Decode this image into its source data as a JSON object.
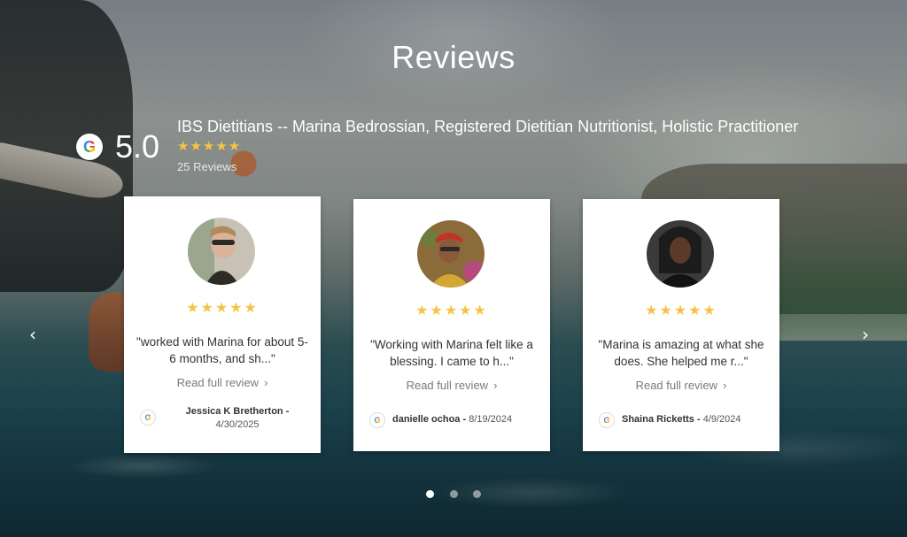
{
  "page": {
    "title": "Reviews"
  },
  "summary": {
    "business_name": "IBS Dietitians -- Marina Bedrossian, Registered Dietitian Nutritionist, Holistic Practitioner",
    "rating": "5.0",
    "stars": "★★★★★",
    "review_count": "25 Reviews",
    "provider_icon": "google-g-icon",
    "provider_letter": "G"
  },
  "carousel": {
    "prev_icon": "‹",
    "next_icon": "›",
    "read_more_label": "Read full review",
    "read_more_chevron": "›",
    "active_dot": 1,
    "dot_count": 3
  },
  "reviews": [
    {
      "stars": "★★★★★",
      "quote": "\"worked with Marina for about 5-6 months, and sh...\"",
      "reviewer_name": "Jessica K Bretherton -",
      "date": "4/30/2025",
      "avatar_colors": [
        "#c8c2b6",
        "#2e2a26",
        "#d9b49a"
      ]
    },
    {
      "stars": "★★★★★",
      "quote": "\"Working with Marina felt like a blessing. I came to h...\"",
      "reviewer_name": "danielle ochoa -",
      "date": "8/19/2024",
      "avatar_colors": [
        "#8c6b3a",
        "#c0322a",
        "#d3a832"
      ]
    },
    {
      "stars": "★★★★★",
      "quote": "\"Marina is amazing at what she does. She helped me r...\"",
      "reviewer_name": "Shaina Ricketts -",
      "date": "4/9/2024",
      "avatar_colors": [
        "#3a3a3a",
        "#5b3a2a",
        "#1c1c1c"
      ]
    }
  ],
  "colors": {
    "star": "#f4c542",
    "card_bg": "#ffffff",
    "title_text": "#ffffff"
  }
}
